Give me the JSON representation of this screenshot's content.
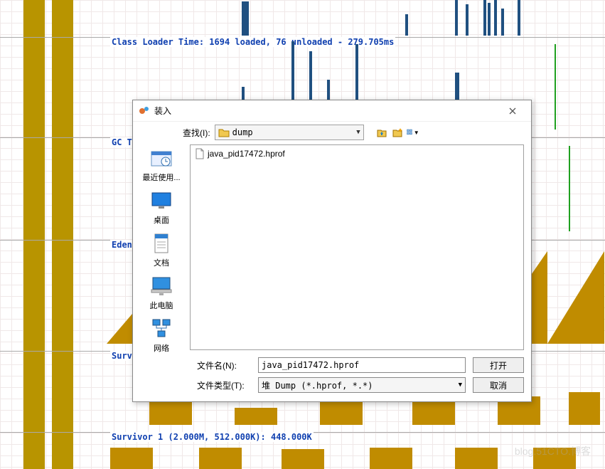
{
  "bg": {
    "class_loader_label": "Class Loader Time: 1694 loaded, 76 unloaded - 279.705ms",
    "gc_label": "GC T",
    "eden_label": "Eden",
    "surv0_label": "Surv",
    "surv1_label": "Survivor 1 (2.000M, 512.000K): 448.000K"
  },
  "dialog": {
    "title": "装入",
    "lookin_label": "查找(I):",
    "lookin_value": "dump",
    "toolbar_icons": [
      "up-icon",
      "new-folder-icon",
      "view-icon"
    ],
    "places": [
      {
        "label": "最近使用...",
        "icon": "recent-icon"
      },
      {
        "label": "桌面",
        "icon": "desktop-icon"
      },
      {
        "label": "文档",
        "icon": "documents-icon"
      },
      {
        "label": "此电脑",
        "icon": "computer-icon"
      },
      {
        "label": "网络",
        "icon": "network-icon"
      }
    ],
    "files": [
      {
        "name": "java_pid17472.hprof"
      }
    ],
    "filename_label": "文件名(N):",
    "filename_value": "java_pid17472.hprof",
    "filetype_label": "文件类型(T):",
    "filetype_value": "堆 Dump (*.hprof, *.*)",
    "open_label": "打开",
    "cancel_label": "取消"
  },
  "watermark": "blog.51CTO.博客"
}
